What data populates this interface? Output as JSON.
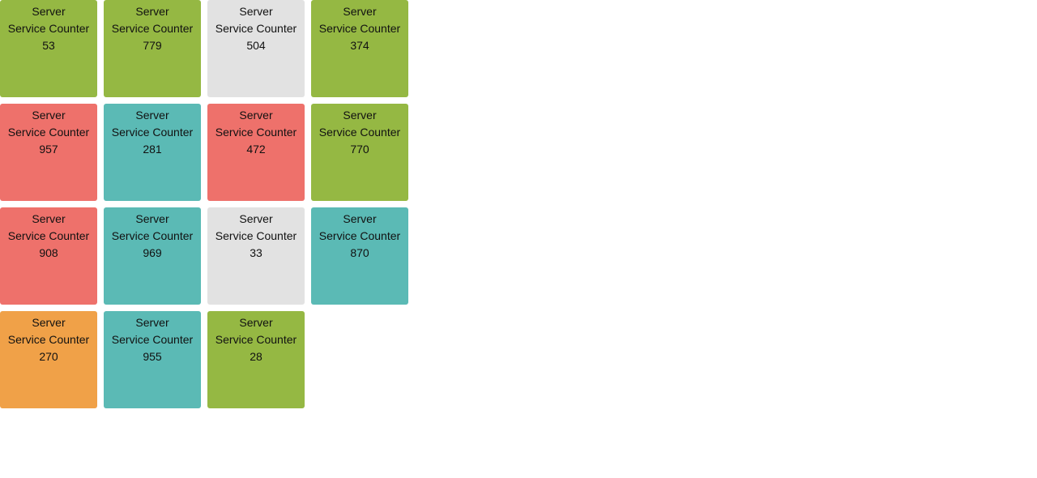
{
  "status_colors": {
    "green": "#95b843",
    "gray": "#e2e2e2",
    "red": "#ee716b",
    "teal": "#5bbab5",
    "orange": "#f0a148"
  },
  "tiles": [
    {
      "title": "Server",
      "subtitle": "Service Counter",
      "value": "53",
      "status": "green"
    },
    {
      "title": "Server",
      "subtitle": "Service Counter",
      "value": "779",
      "status": "green"
    },
    {
      "title": "Server",
      "subtitle": "Service Counter",
      "value": "504",
      "status": "gray"
    },
    {
      "title": "Server",
      "subtitle": "Service Counter",
      "value": "374",
      "status": "green"
    },
    {
      "title": "Server",
      "subtitle": "Service Counter",
      "value": "957",
      "status": "red"
    },
    {
      "title": "Server",
      "subtitle": "Service Counter",
      "value": "281",
      "status": "teal"
    },
    {
      "title": "Server",
      "subtitle": "Service Counter",
      "value": "472",
      "status": "red"
    },
    {
      "title": "Server",
      "subtitle": "Service Counter",
      "value": "770",
      "status": "green"
    },
    {
      "title": "Server",
      "subtitle": "Service Counter",
      "value": "908",
      "status": "red"
    },
    {
      "title": "Server",
      "subtitle": "Service Counter",
      "value": "969",
      "status": "teal"
    },
    {
      "title": "Server",
      "subtitle": "Service Counter",
      "value": "33",
      "status": "gray"
    },
    {
      "title": "Server",
      "subtitle": "Service Counter",
      "value": "870",
      "status": "teal"
    },
    {
      "title": "Server",
      "subtitle": "Service Counter",
      "value": "270",
      "status": "orange"
    },
    {
      "title": "Server",
      "subtitle": "Service Counter",
      "value": "955",
      "status": "teal"
    },
    {
      "title": "Server",
      "subtitle": "Service Counter",
      "value": "28",
      "status": "green"
    }
  ]
}
